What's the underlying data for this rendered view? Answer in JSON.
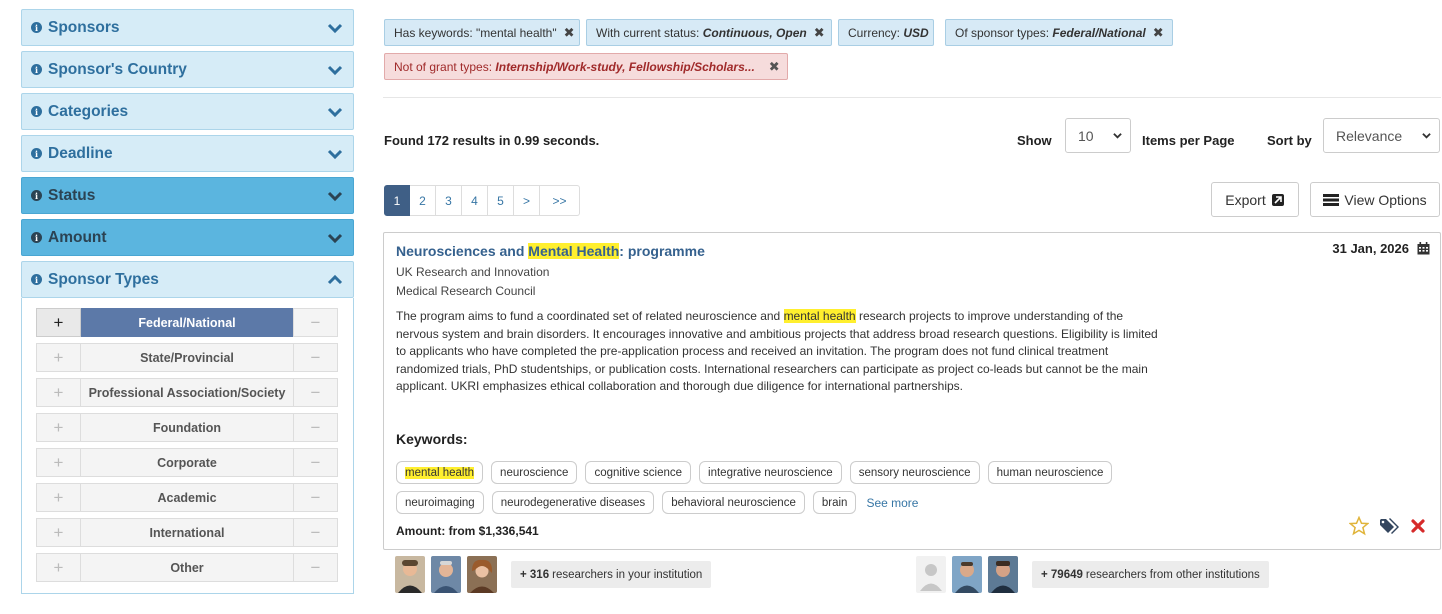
{
  "sidebar": {
    "sections": [
      {
        "title": "Sponsors",
        "state": "collapsed"
      },
      {
        "title": "Sponsor's Country",
        "state": "collapsed"
      },
      {
        "title": "Categories",
        "state": "collapsed"
      },
      {
        "title": "Deadline",
        "state": "collapsed"
      },
      {
        "title": "Status",
        "state": "collapsed"
      },
      {
        "title": "Amount",
        "state": "collapsed"
      },
      {
        "title": "Sponsor Types",
        "state": "expanded"
      }
    ],
    "sponsor_types": [
      {
        "label": "Federal/National",
        "selected": true
      },
      {
        "label": "State/Provincial",
        "selected": false
      },
      {
        "label": "Professional Association/Society",
        "selected": false
      },
      {
        "label": "Foundation",
        "selected": false
      },
      {
        "label": "Corporate",
        "selected": false
      },
      {
        "label": "Academic",
        "selected": false
      },
      {
        "label": "International",
        "selected": false
      },
      {
        "label": "Other",
        "selected": false
      }
    ],
    "plus_glyph": "+",
    "minus_glyph": "−"
  },
  "filters": {
    "keywords": {
      "prefix": "Has keywords: \"mental health\"",
      "value": ""
    },
    "status": {
      "prefix": "With current status: ",
      "value": "Continuous, Open"
    },
    "currency": {
      "prefix": "Currency: ",
      "value": "USD"
    },
    "sponsor_types": {
      "prefix": "Of sponsor types: ",
      "value": "Federal/National"
    },
    "grant_types": {
      "prefix": "Not of grant types: ",
      "value": "Internship/Work-study, Fellowship/Scholars..."
    },
    "remove_glyph": "✖"
  },
  "results": {
    "found_text": "Found 172 results in 0.99 seconds.",
    "show_label": "Show",
    "per_page_value": "10",
    "items_per_page_label": "Items per Page",
    "sort_by_label": "Sort by",
    "sort_value": "Relevance"
  },
  "pagination": {
    "pages": [
      "1",
      "2",
      "3",
      "4",
      "5",
      ">",
      ">>"
    ],
    "active": "1"
  },
  "toolbar": {
    "export_label": "Export",
    "view_options_label": "View Options"
  },
  "result": {
    "title_pre": "Neurosciences and ",
    "title_hl": "Mental Health",
    "title_post": ": programme",
    "date": "31 Jan, 2026",
    "sponsor": "UK Research and Innovation",
    "sub_sponsor": "Medical Research Council",
    "desc_pre": "The program aims to fund a coordinated set of related neuroscience and ",
    "desc_hl": "mental health",
    "desc_post": " research projects to improve understanding of the nervous system and brain disorders. It encourages innovative and ambitious projects that address broad research questions. Eligibility is limited to applicants who have completed the pre-application process and received an invitation. The program does not fund clinical treatment randomized trials, PhD studentships, or publication costs. International researchers can participate as project co-leads but cannot be the main applicant. UKRI emphasizes ethical collaboration and thorough due diligence for international partnerships.",
    "keywords_title": "Keywords:",
    "keywords": [
      "mental health",
      "neuroscience",
      "cognitive science",
      "integrative neuroscience",
      "sensory neuroscience",
      "human neuroscience",
      "neuroimaging",
      "neurodegenerative diseases",
      "behavioral neuroscience",
      "brain"
    ],
    "see_more": "See more",
    "amount": "Amount: from $1,336,541",
    "colors": {
      "star": "#e0b43a",
      "tag": "#33455e",
      "remove": "#d62a2a",
      "highlight": "#ffef2e"
    }
  },
  "researchers": {
    "internal_count": "+ 316",
    "internal_text": " researchers in your institution",
    "external_count": "+ 79649",
    "external_text": " researchers from other institutions"
  }
}
